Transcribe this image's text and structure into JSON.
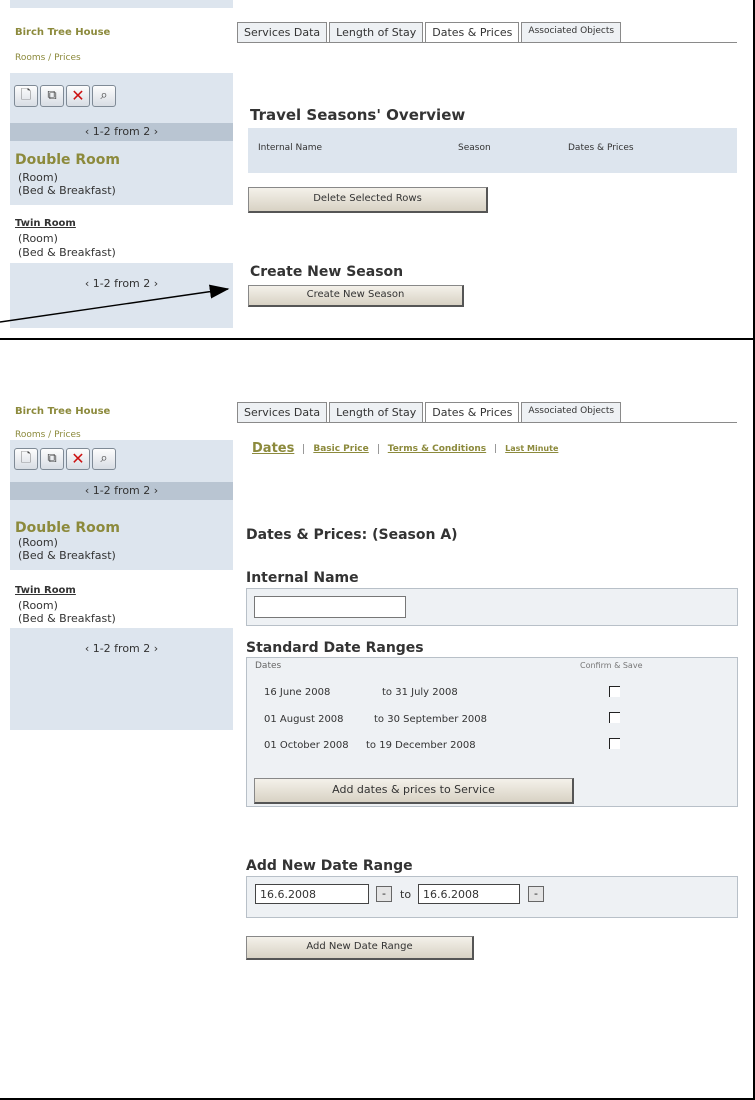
{
  "screen_a": {
    "sidebar": {
      "hotel": "Birch Tree House",
      "section": "Rooms / Prices",
      "pager_top": "‹ 1-2 from 2 ›",
      "pager_bottom": "‹ 1-2 from 2 ›",
      "items": [
        {
          "title": "Double Room",
          "line1": "(Room)",
          "line2": "(Bed & Breakfast)"
        },
        {
          "title": "Twin Room",
          "line1": "(Room)",
          "line2": "(Bed & Breakfast)"
        }
      ]
    },
    "tabs": [
      "Services Data",
      "Length of Stay",
      "Dates & Prices",
      "Associated Objects"
    ],
    "overview": {
      "heading": "Travel Seasons' Overview",
      "columns": [
        "Internal Name",
        "Season",
        "Dates & Prices"
      ],
      "delete_button": "Delete Selected Rows"
    },
    "create": {
      "heading": "Create New Season",
      "button": "Create New Season"
    }
  },
  "screen_b": {
    "sidebar": {
      "hotel": "Birch Tree House",
      "section": "Rooms / Prices",
      "pager_top": "‹ 1-2 from 2 ›",
      "pager_bottom": "‹ 1-2 from 2 ›",
      "items": [
        {
          "title": "Double Room",
          "line1": "(Room)",
          "line2": "(Bed & Breakfast)"
        },
        {
          "title": "Twin Room",
          "line1": "(Room)",
          "line2": "(Bed & Breakfast)"
        }
      ]
    },
    "tabs": [
      "Services Data",
      "Length of Stay",
      "Dates & Prices",
      "Associated Objects"
    ],
    "subtabs": [
      "Dates",
      "Basic Price",
      "Terms & Conditions",
      "Last Minute"
    ],
    "page_title": "Dates & Prices: (Season A)",
    "internal_name": {
      "label": "Internal Name",
      "value": ""
    },
    "date_ranges": {
      "heading": "Standard Date Ranges",
      "dates_label": "Dates",
      "confirm_label": "Confirm & Save",
      "rows": [
        {
          "from": "16 June 2008",
          "to": "to 31 July 2008"
        },
        {
          "from": "01 August 2008",
          "to": "to 30 September 2008"
        },
        {
          "from": "01 October 2008",
          "to": "to 19 December 2008"
        }
      ],
      "add_button": "Add dates & prices to Service"
    },
    "new_range": {
      "heading": "Add New Date Range",
      "from_value": "16.6.2008",
      "to_label": "to",
      "to_value": "16.6.2008",
      "picker_icon": "-",
      "button": "Add New Date Range"
    }
  },
  "colors": {
    "sidebar_bg": "#dde5ee",
    "olive_text": "#8c8a3c",
    "delete_icon": "#cc1111"
  }
}
